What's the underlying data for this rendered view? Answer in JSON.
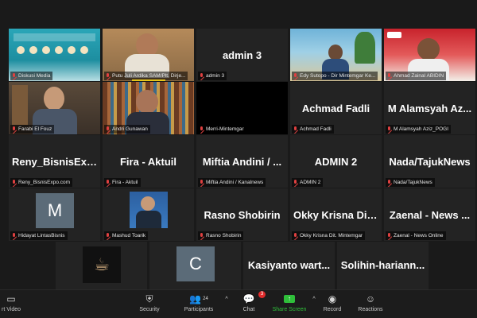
{
  "tiles": {
    "r1": [
      {
        "caption": "Diskusi Media"
      },
      {
        "caption": "Putu Juli Ardika SAM/Plt. Dirje..."
      },
      {
        "name": "admin 3",
        "caption": "admin 3"
      },
      {
        "caption": "Edy Sutopo - Dir Mintemgar Ke..."
      },
      {
        "caption": "Ahmad Zainal ABIDIN"
      }
    ],
    "r2": [
      {
        "caption": "Farabi El Fouz"
      },
      {
        "caption": "Andri Gunawan"
      },
      {
        "caption": "Merri-Mintemgar"
      },
      {
        "name": "Achmad Fadli",
        "caption": "Achmad Fadli"
      },
      {
        "name": "M Alamsyah Az...",
        "caption": "M Alamsyah Aziz_POGI"
      }
    ],
    "r3": [
      {
        "name": "Reny_BisnisExp...",
        "caption": "Reny_BisnisExpo.com"
      },
      {
        "name": "Fira - Aktuil",
        "caption": "Fira - Aktuil"
      },
      {
        "name": "Miftia Andini / ...",
        "caption": "Miftia Andini / Kanalnews"
      },
      {
        "name": "ADMIN 2",
        "caption": "ADMIN 2"
      },
      {
        "name": "Nada/TajukNews",
        "caption": "Nada/TajukNews"
      }
    ],
    "r4": [
      {
        "avatar": "M",
        "caption": "Hidayat LintasBisnis"
      },
      {
        "caption": "Mashud Toarik"
      },
      {
        "name": "Rasno Shobirin",
        "caption": "Rasno Shobirin"
      },
      {
        "name": "Okky Krisna Dit...",
        "caption": "Okky Krisna Dit. Mintemgar"
      },
      {
        "name": "Zaenal - News ...",
        "caption": "Zaenal - News Online"
      }
    ],
    "r5": [
      {
        "caption": ""
      },
      {
        "avatar": "C",
        "caption": ""
      },
      {
        "name": "Kasiyanto  wart...",
        "caption": ""
      },
      {
        "name": "Solihin-hariann...",
        "caption": ""
      }
    ]
  },
  "toolbar": {
    "video_label": "rt Video",
    "security_label": "Security",
    "participants_label": "Participants",
    "participants_count": "24",
    "chat_label": "Chat",
    "chat_badge": "3",
    "share_label": "Share Screen",
    "record_label": "Record",
    "reactions_label": "Reactions"
  },
  "colors": {
    "active_border": "#8bc34a",
    "share_green": "#2fbf3a",
    "muted_red": "#e04040"
  }
}
